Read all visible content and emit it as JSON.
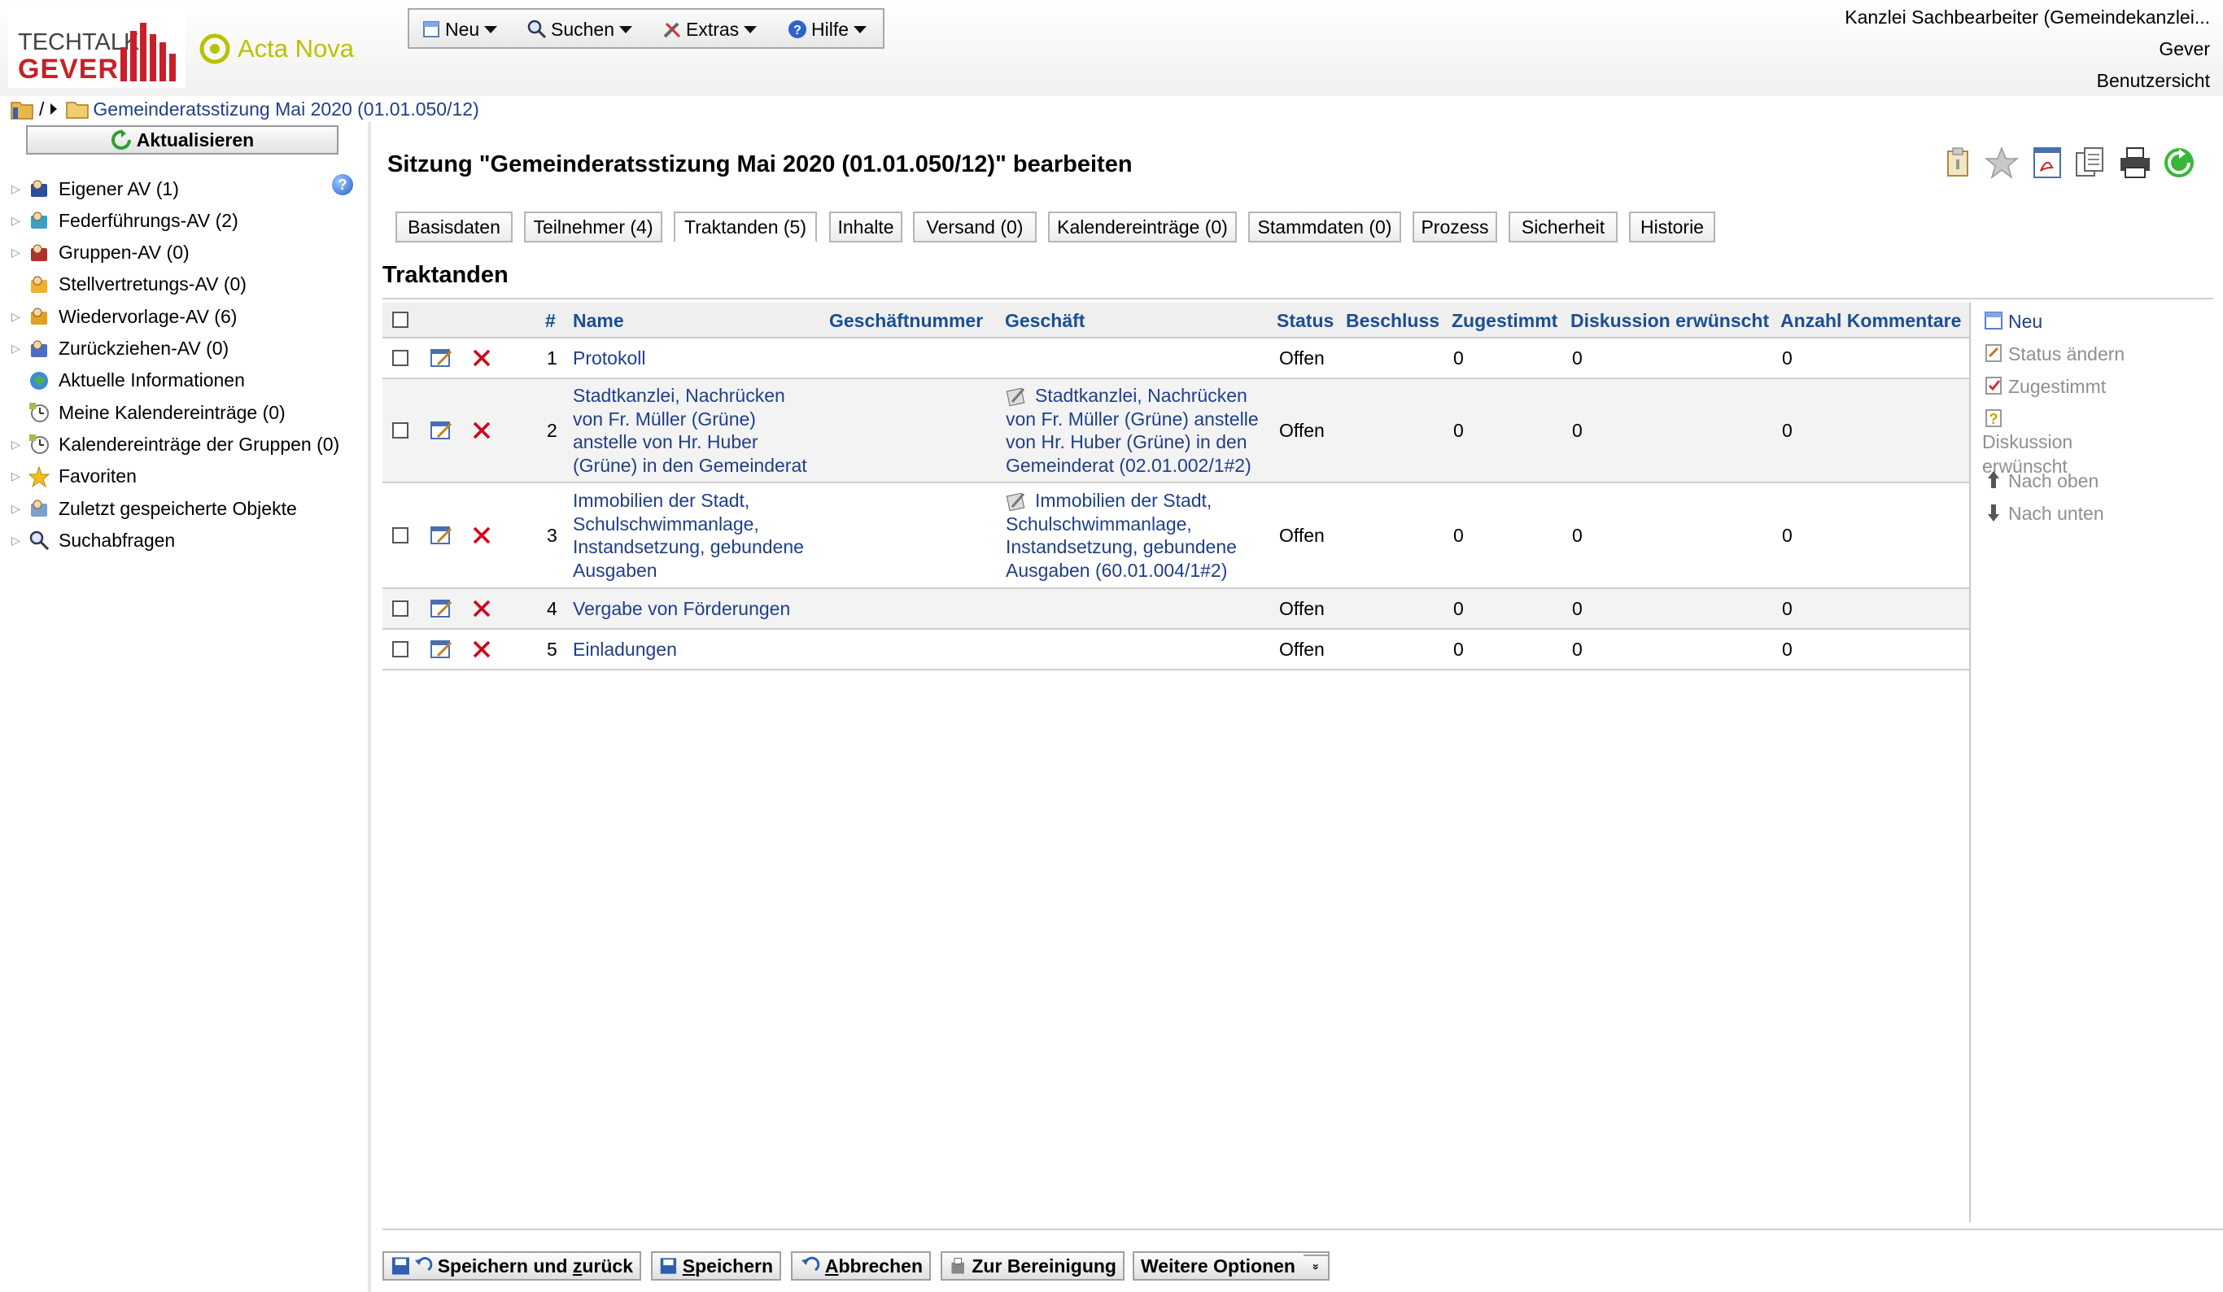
{
  "logos": {
    "techtalk_line1": "TECHTALK",
    "techtalk_line2": "GEVER",
    "acta": "Acta Nova"
  },
  "menu": [
    {
      "label": "Neu",
      "icon": "new-doc-icon"
    },
    {
      "label": "Suchen",
      "icon": "magnifier-icon"
    },
    {
      "label": "Extras",
      "icon": "tools-icon"
    },
    {
      "label": "Hilfe",
      "icon": "help-icon"
    }
  ],
  "user": {
    "role": "Kanzlei Sachbearbeiter (Gemeindekanzlei...",
    "org": "Gever",
    "view": "Benutzersicht"
  },
  "breadcrumb": {
    "separator": "/",
    "current": "Gemeinderatsstizung Mai 2020 (01.01.050/12)"
  },
  "sidebar": {
    "refresh_label": "Aktualisieren",
    "items": [
      {
        "label": "Eigener AV (1)",
        "icon": "user-inbox-icon",
        "expandable": true
      },
      {
        "label": "Federführungs-AV (2)",
        "icon": "feather-icon",
        "expandable": true
      },
      {
        "label": "Gruppen-AV (0)",
        "icon": "group-icon",
        "expandable": true
      },
      {
        "label": "Stellvertretungs-AV (0)",
        "icon": "deputy-icon",
        "expandable": false
      },
      {
        "label": "Wiedervorlage-AV (6)",
        "icon": "resubmit-icon",
        "expandable": true
      },
      {
        "label": "Zurückziehen-AV (0)",
        "icon": "withdraw-icon",
        "expandable": true
      },
      {
        "label": "Aktuelle Informationen",
        "icon": "globe-icon",
        "expandable": false
      },
      {
        "label": "Meine Kalendereinträge (0)",
        "icon": "clock-icon",
        "expandable": false
      },
      {
        "label": "Kalendereinträge der Gruppen (0)",
        "icon": "group-clock-icon",
        "expandable": true
      },
      {
        "label": "Favoriten",
        "icon": "star-icon",
        "expandable": true
      },
      {
        "label": "Zuletzt gespeicherte Objekte",
        "icon": "recent-icon",
        "expandable": true
      },
      {
        "label": "Suchabfragen",
        "icon": "search-query-icon",
        "expandable": true
      }
    ]
  },
  "main": {
    "title": "Sitzung \"Gemeinderatsstizung Mai 2020 (01.01.050/12)\" bearbeiten",
    "toolbar_icons": [
      "clipboard-icon",
      "star-icon",
      "pdf-icon",
      "copy-icon",
      "print-icon",
      "refresh-icon"
    ],
    "tabs": [
      {
        "label": "Basisdaten",
        "active": false
      },
      {
        "label": "Teilnehmer (4)",
        "active": false
      },
      {
        "label": "Traktanden (5)",
        "active": true
      },
      {
        "label": "Inhalte",
        "active": false
      },
      {
        "label": "Versand (0)",
        "active": false
      },
      {
        "label": "Kalendereinträge (0)",
        "active": false
      },
      {
        "label": "Stammdaten (0)",
        "active": false
      },
      {
        "label": "Prozess",
        "active": false
      },
      {
        "label": "Sicherheit",
        "active": false
      },
      {
        "label": "Historie",
        "active": false
      }
    ],
    "section_title": "Traktanden",
    "columns": [
      "#",
      "Name",
      "Geschäftnummer",
      "Geschäft",
      "Status",
      "Beschluss",
      "Zugestimmt",
      "Diskussion erwünscht",
      "Anzahl Kommentare"
    ],
    "rows": [
      {
        "nr": "1",
        "name": [
          "Protokoll"
        ],
        "geschaeft": [],
        "status": "Offen",
        "zugestimmt": "0",
        "diskussion": "0",
        "kommentare": "0"
      },
      {
        "nr": "2",
        "name": [
          "Stadtkanzlei, Nachrücken",
          "von Fr. Müller (Grüne)",
          "anstelle von Hr. Huber",
          "(Grüne) in den Gemeinderat"
        ],
        "geschaeft": [
          "Stadtkanzlei, Nachrücken",
          "von Fr. Müller (Grüne) anstelle",
          "von Hr. Huber (Grüne) in den",
          "Gemeinderat (02.01.002/1#2)"
        ],
        "status": "Offen",
        "zugestimmt": "0",
        "diskussion": "0",
        "kommentare": "0"
      },
      {
        "nr": "3",
        "name": [
          "Immobilien der Stadt,",
          "Schulschwimmanlage,",
          "Instandsetzung, gebundene",
          "Ausgaben"
        ],
        "geschaeft": [
          "Immobilien der Stadt,",
          "Schulschwimmanlage,",
          "Instandsetzung, gebundene",
          "Ausgaben (60.01.004/1#2)"
        ],
        "status": "Offen",
        "zugestimmt": "0",
        "diskussion": "0",
        "kommentare": "0"
      },
      {
        "nr": "4",
        "name": [
          "Vergabe von Förderungen"
        ],
        "geschaeft": [],
        "status": "Offen",
        "zugestimmt": "0",
        "diskussion": "0",
        "kommentare": "0"
      },
      {
        "nr": "5",
        "name": [
          "Einladungen"
        ],
        "geschaeft": [],
        "status": "Offen",
        "zugestimmt": "0",
        "diskussion": "0",
        "kommentare": "0"
      }
    ],
    "side_actions": [
      {
        "label": "Neu",
        "enabled": true
      },
      {
        "label": "Status ändern",
        "enabled": false
      },
      {
        "label": "Zugestimmt",
        "enabled": false
      },
      {
        "label": "Diskussion erwünscht",
        "enabled": false
      },
      {
        "label": "Nach oben",
        "enabled": false
      },
      {
        "label": "Nach unten",
        "enabled": false
      }
    ],
    "bottom_buttons": [
      {
        "label": "Speichern und zurück",
        "accesskey": "z"
      },
      {
        "label": "Speichern",
        "accesskey": "S"
      },
      {
        "label": "Abbrechen",
        "accesskey": "A"
      },
      {
        "label": "Zur Bereinigung",
        "accesskey": ""
      },
      {
        "label": "Weitere Optionen",
        "accesskey": ""
      }
    ]
  },
  "colors": {
    "link": "#1f3f8a",
    "header_text": "#1b4f91",
    "delete": "#d0021b",
    "brand_red": "#c8202a",
    "acta_green": "#b9c200"
  }
}
